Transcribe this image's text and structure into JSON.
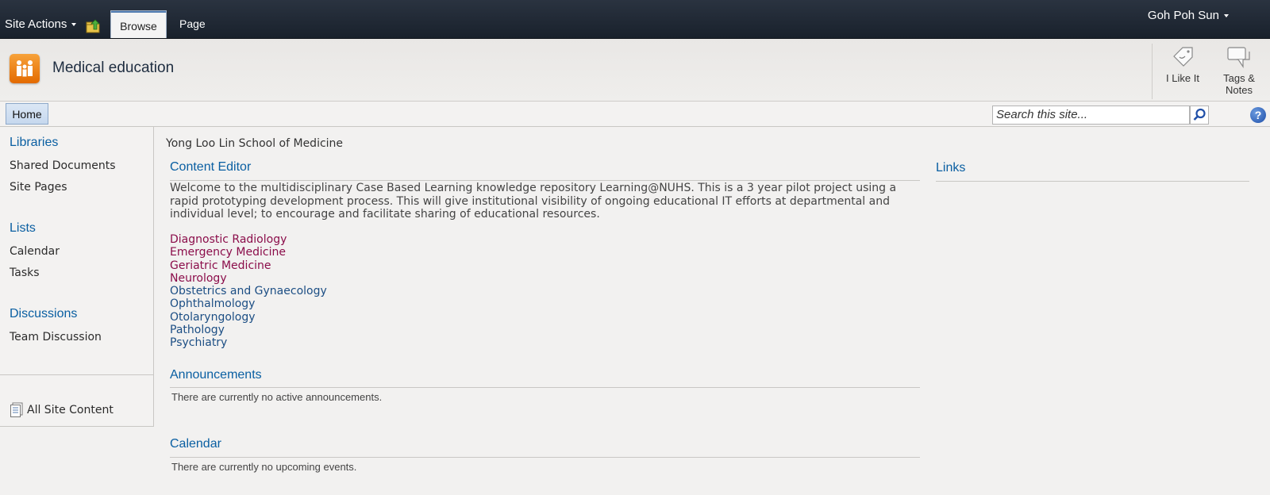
{
  "ribbon": {
    "site_actions": "Site Actions",
    "tabs": [
      {
        "label": "Browse"
      },
      {
        "label": "Page"
      }
    ],
    "user": "Goh Poh Sun"
  },
  "title_area": {
    "site_title": "Medical education",
    "social": [
      {
        "label": "I Like It",
        "icon": "thumbs-up-tag-icon"
      },
      {
        "label": "Tags & Notes",
        "icon": "tag-note-icon"
      }
    ]
  },
  "topnav": {
    "home": "Home",
    "search_placeholder": "Search this site...",
    "help": "?"
  },
  "leftnav": {
    "sections": [
      {
        "heading": "Libraries",
        "items": [
          "Shared Documents",
          "Site Pages"
        ]
      },
      {
        "heading": "Lists",
        "items": [
          "Calendar",
          "Tasks"
        ]
      },
      {
        "heading": "Discussions",
        "items": [
          "Team Discussion"
        ]
      }
    ],
    "all_site_content": "All Site Content"
  },
  "main": {
    "page_title": "Yong Loo Lin School of Medicine",
    "content_editor": {
      "title": "Content Editor",
      "welcome_text": "Welcome to the multidisciplinary Case Based Learning knowledge repository Learning@NUHS. This is a 3 year pilot project using a rapid prototyping development process. This will give institutional visibility of ongoing educational IT efforts at departmental and individual level; to encourage and facilitate sharing of educational resources.",
      "links": [
        {
          "label": "Diagnostic Radiology",
          "visited": true
        },
        {
          "label": "Emergency Medicine",
          "visited": true
        },
        {
          "label": "Geriatric Medicine",
          "visited": true
        },
        {
          "label": "Neurology",
          "visited": true
        },
        {
          "label": "Obstetrics and Gynaecology",
          "visited": false
        },
        {
          "label": "Ophthalmology",
          "visited": false
        },
        {
          "label": "Otolaryngology",
          "visited": false
        },
        {
          "label": "Pathology",
          "visited": false
        },
        {
          "label": "Psychiatry",
          "visited": false
        }
      ]
    },
    "announcements": {
      "title": "Announcements",
      "empty": "There are currently no active announcements."
    },
    "calendar": {
      "title": "Calendar",
      "empty": "There are currently no upcoming events."
    },
    "links_part": {
      "title": "Links"
    }
  },
  "colors": {
    "ribbon_bg": "#1f2833",
    "heading_blue": "#0a5fa2",
    "visited_link": "#8b0d4a",
    "unvisited_link": "#1c4e84",
    "logo_orange": "#f08a1c"
  }
}
